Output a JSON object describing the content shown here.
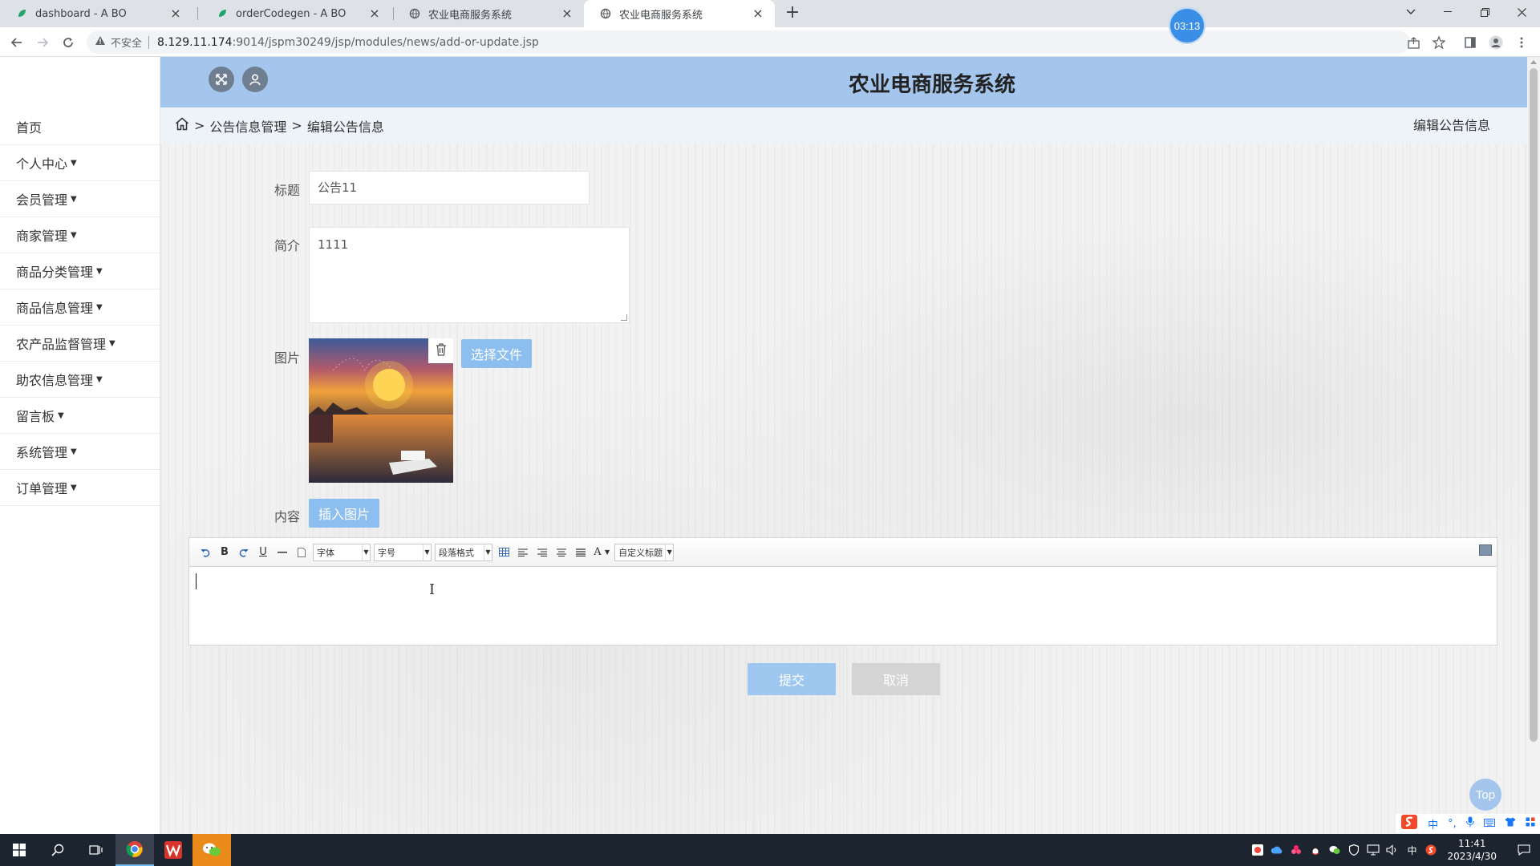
{
  "browser": {
    "tabs": [
      {
        "title": "dashboard - A BO",
        "favicon": "leaf-icon",
        "color": "#21a36b"
      },
      {
        "title": "orderCodegen - A BO",
        "favicon": "leaf-icon",
        "color": "#21a36b"
      },
      {
        "title": "农业电商服务系统",
        "favicon": "globe-icon",
        "color": "#5f6368"
      },
      {
        "title": "农业电商服务系统",
        "favicon": "globe-icon",
        "color": "#5f6368"
      }
    ],
    "timer": "03:13",
    "insecure_label": "不安全",
    "url_host": "8.129.11.174",
    "url_path": ":9014/jspm30249/jsp/modules/news/add-or-update.jsp"
  },
  "app": {
    "title": "农业电商服务系统",
    "accent_color": "#a4c5ec"
  },
  "sidebar": {
    "items": [
      {
        "label": "首页",
        "has_caret": false
      },
      {
        "label": "个人中心",
        "has_caret": true
      },
      {
        "label": "会员管理",
        "has_caret": true
      },
      {
        "label": "商家管理",
        "has_caret": true
      },
      {
        "label": "商品分类管理",
        "has_caret": true
      },
      {
        "label": "商品信息管理",
        "has_caret": true
      },
      {
        "label": "农产品监督管理",
        "has_caret": true
      },
      {
        "label": "助农信息管理",
        "has_caret": true
      },
      {
        "label": "留言板",
        "has_caret": true
      },
      {
        "label": "系统管理",
        "has_caret": true
      },
      {
        "label": "订单管理",
        "has_caret": true
      }
    ]
  },
  "breadcrumb": {
    "sep": ">",
    "level1": "公告信息管理",
    "level2": "编辑公告信息"
  },
  "page_subtitle": "编辑公告信息",
  "form": {
    "title_label": "标题",
    "title_value": "公告11",
    "intro_label": "简介",
    "intro_value": "1111",
    "image_label": "图片",
    "choose_file_label": "选择文件",
    "content_label": "内容",
    "insert_image_label": "插入图片",
    "submit_label": "提交",
    "cancel_label": "取消"
  },
  "editor": {
    "font_select": "字体",
    "size_select": "字号",
    "paragraph_select": "段落格式",
    "custom_title_select": "自定义标题",
    "bold": "B",
    "underline": "U",
    "font_color": "A"
  },
  "top_button": "Top",
  "ime": {
    "lang": "中"
  },
  "taskbar": {
    "lang": "中",
    "time": "11:41",
    "date": "2023/4/30"
  }
}
